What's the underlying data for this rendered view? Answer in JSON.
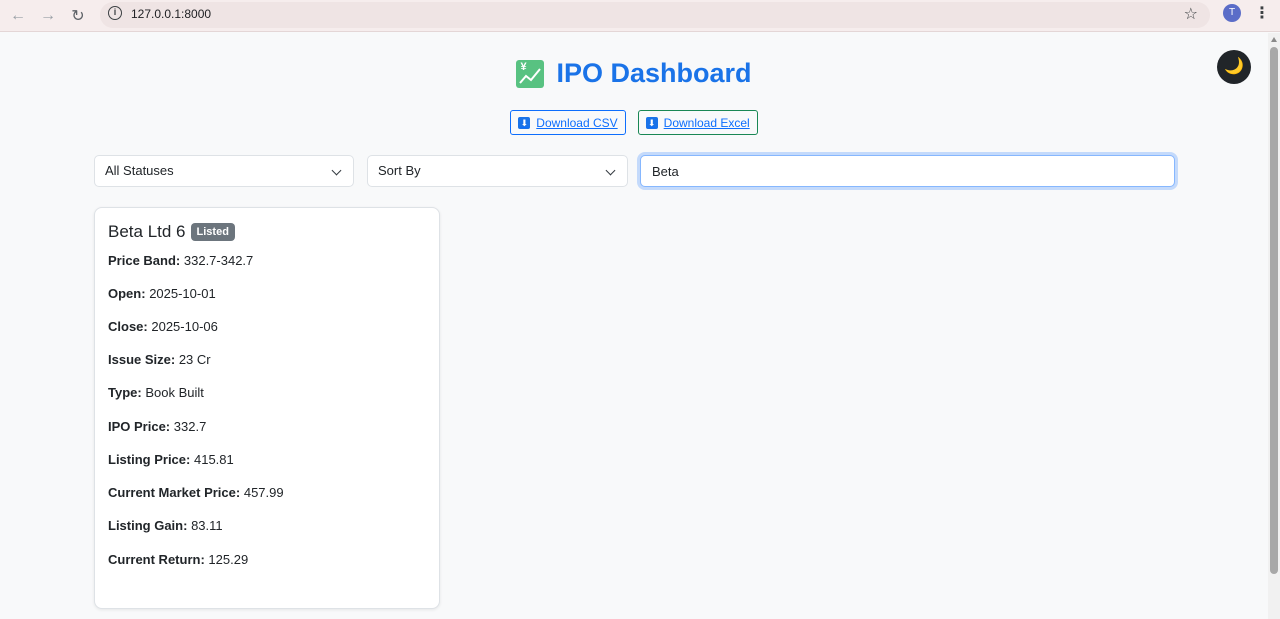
{
  "browser": {
    "url": "127.0.0.1:8000",
    "profile_initial": "T"
  },
  "header": {
    "title": "IPO Dashboard",
    "title_icon": "chart-increasing-yen-icon",
    "theme_toggle_icon": "crescent-moon-icon"
  },
  "downloads": {
    "csv_label": "Download CSV",
    "excel_label": "Download Excel",
    "icon": "down-arrow-icon"
  },
  "filters": {
    "status_selected": "All Statuses",
    "sort_selected": "Sort By",
    "search_value": "Beta"
  },
  "cards": [
    {
      "name": "Beta Ltd 6",
      "status": "Listed",
      "fields": [
        {
          "label": "Price Band:",
          "value": "332.7-342.7"
        },
        {
          "label": "Open:",
          "value": "2025-10-01"
        },
        {
          "label": "Close:",
          "value": "2025-10-06"
        },
        {
          "label": "Issue Size:",
          "value": "23 Cr"
        },
        {
          "label": "Type:",
          "value": "Book Built"
        },
        {
          "label": "IPO Price:",
          "value": "332.7"
        },
        {
          "label": "Listing Price:",
          "value": "415.81"
        },
        {
          "label": "Current Market Price:",
          "value": "457.99"
        },
        {
          "label": "Listing Gain:",
          "value": "83.11"
        },
        {
          "label": "Current Return:",
          "value": "125.29"
        }
      ]
    }
  ],
  "colors": {
    "title": "#1a73e8",
    "badge": "#6c757d",
    "csv_border": "#0d6efd",
    "excel_border": "#198754"
  }
}
